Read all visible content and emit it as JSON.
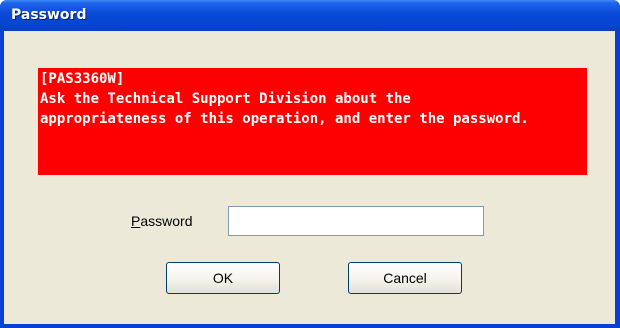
{
  "window": {
    "title": "Password"
  },
  "message": {
    "lines": [
      "[PAS3360W]",
      "Ask the Technical Support Division about the",
      "appropriateness of this operation, and enter the password."
    ],
    "background_color": "#ff0000"
  },
  "form": {
    "password_label_accel": "P",
    "password_label_rest": "assword",
    "password_value": ""
  },
  "buttons": {
    "ok": "OK",
    "cancel": "Cancel"
  },
  "colors": {
    "titlebar": "#0a4ad8",
    "dialog_bg": "#ece9d8"
  }
}
